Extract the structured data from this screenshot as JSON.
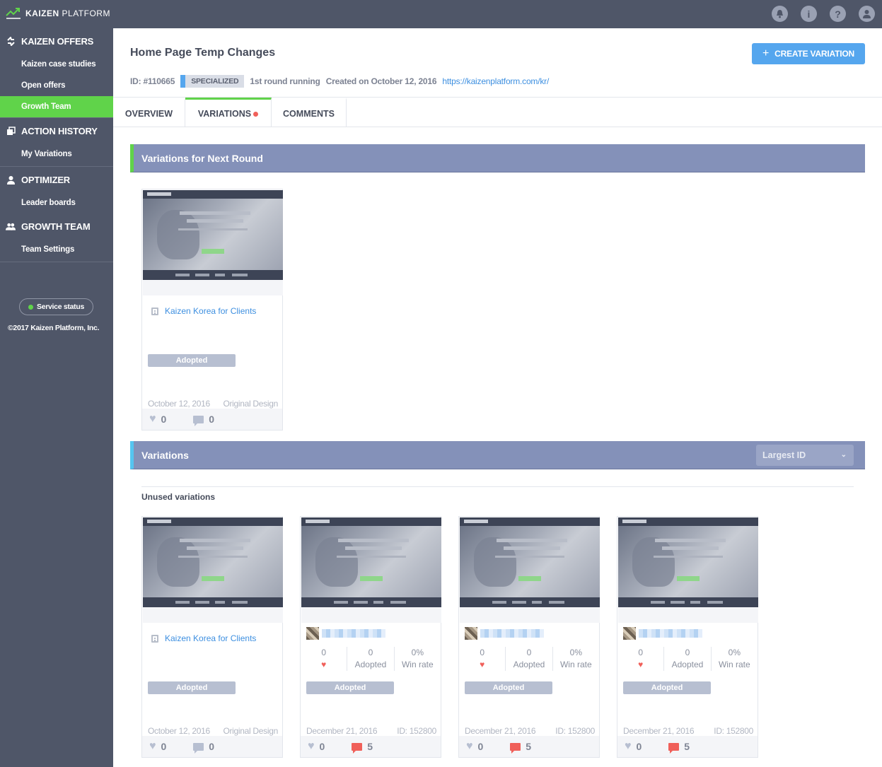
{
  "app": {
    "brand_bold": "KAIZEN",
    "brand_thin": "PLATFORM"
  },
  "topbar": {
    "icons": [
      "bell-icon",
      "info-icon",
      "help-icon",
      "user-icon"
    ]
  },
  "sidebar": {
    "sections": [
      {
        "title": "KAIZEN OFFERS",
        "icon": "offers-icon",
        "items": [
          "Kaizen case studies",
          "Open offers",
          "Growth Team"
        ]
      },
      {
        "title": "ACTION HISTORY",
        "icon": "history-icon",
        "items": [
          "My Variations"
        ]
      },
      {
        "title": "OPTIMIZER",
        "icon": "person-icon",
        "items": [
          "Leader boards"
        ]
      },
      {
        "title": "GROWTH TEAM",
        "icon": "team-icon",
        "items": [
          "Team Settings"
        ]
      }
    ],
    "active_item": "Growth Team",
    "service_status": "Service status",
    "copyright": "©2017 Kaizen Platform, Inc."
  },
  "header": {
    "title": "Home Page Temp Changes",
    "create_button": "CREATE VARIATION",
    "id_label": "ID: #110665",
    "badge": "SPECIALIZED",
    "round_status": "1st round running",
    "created": "Created on October 12, 2016",
    "url": "https://kaizenplatform.com/kr/"
  },
  "tabs": [
    {
      "label": "OVERVIEW",
      "active": false
    },
    {
      "label": "VARIATIONS",
      "active": true,
      "has_dot": true
    },
    {
      "label": "COMMENTS",
      "active": false
    }
  ],
  "next_round": {
    "title": "Variations for Next Round",
    "cards": [
      {
        "client": "Kaizen Korea for Clients",
        "button": "Adopted",
        "date": "October 12, 2016",
        "tag": "Original Design",
        "likes": "0",
        "comments": "0"
      }
    ]
  },
  "variations": {
    "title": "Variations",
    "sort": "Largest ID",
    "subheading": "Unused variations",
    "cards": [
      {
        "client": "Kaizen Korea for Clients",
        "button": "Adopted",
        "date": "October 12, 2016",
        "tag": "Original Design",
        "likes": "0",
        "comments": "0"
      },
      {
        "stats": [
          "0",
          "0",
          "0%"
        ],
        "stat_labels": [
          "",
          "Adopted",
          "Win rate"
        ],
        "button": "Adopted",
        "date": "December 21, 2016",
        "tag": "ID: 152800",
        "likes": "0",
        "comments": "5"
      },
      {
        "stats": [
          "0",
          "0",
          "0%"
        ],
        "stat_labels": [
          "",
          "Adopted",
          "Win rate"
        ],
        "button": "Adopted",
        "date": "December 21, 2016",
        "tag": "ID: 152800",
        "likes": "0",
        "comments": "5"
      },
      {
        "stats": [
          "0",
          "0",
          "0%"
        ],
        "stat_labels": [
          "",
          "Adopted",
          "Win rate"
        ],
        "button": "Adopted",
        "date": "December 21, 2016",
        "tag": "ID: 152800",
        "likes": "0",
        "comments": "5"
      }
    ]
  },
  "colors": {
    "sidebar": "#4f5668",
    "accent_green": "#60d34a",
    "accent_blue": "#55a6ee",
    "section_bar": "#8491b9"
  }
}
